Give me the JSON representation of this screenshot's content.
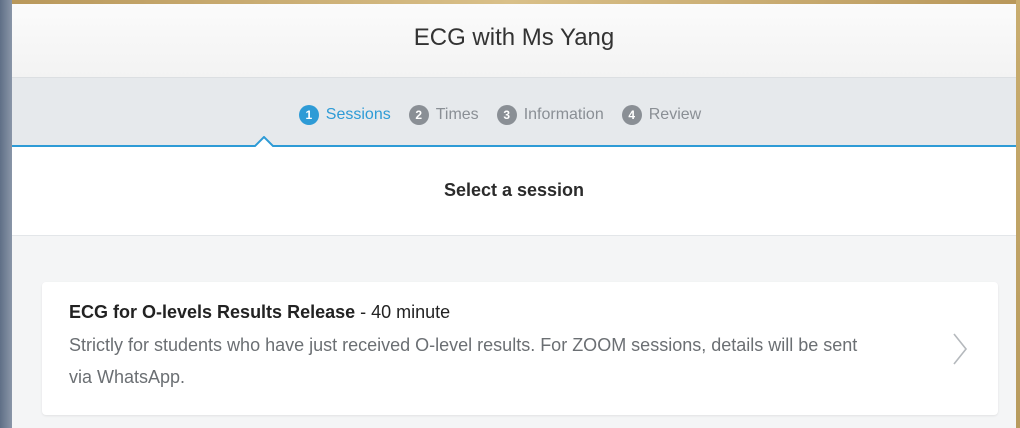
{
  "header": {
    "title": "ECG with Ms Yang"
  },
  "steps": [
    {
      "num": "1",
      "label": "Sessions",
      "active": true
    },
    {
      "num": "2",
      "label": "Times",
      "active": false
    },
    {
      "num": "3",
      "label": "Information",
      "active": false
    },
    {
      "num": "4",
      "label": "Review",
      "active": false
    }
  ],
  "subheader": {
    "title": "Select a session"
  },
  "sessions": [
    {
      "name": "ECG for O-levels Results Release",
      "duration": " - 40 minute",
      "description": "Strictly for students who have just received O-level results. For ZOOM sessions, details will be sent via WhatsApp."
    }
  ],
  "colors": {
    "accent": "#2e9bd6",
    "inactive_step": "#8a8f95"
  }
}
